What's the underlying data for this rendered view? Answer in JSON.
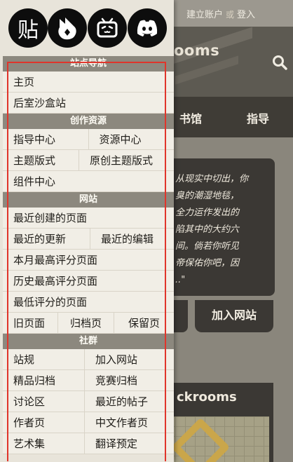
{
  "background": {
    "create_account": "建立账户",
    "or": "或",
    "login": "登入",
    "site_name_partial": "ooms",
    "nav_library": "书馆",
    "nav_guide": "指导",
    "quote_lines": [
      "从现实中切出，你",
      "臭的潮湿地毯，",
      "全力运作发出的",
      "陷其中的大约六",
      "间。倘若你听见",
      "帝保佑你吧，因",
      "..\""
    ],
    "join_button": "加入网站",
    "card_title": "ckrooms"
  },
  "social": {
    "tieba_glyph": "贴",
    "icons": [
      "tieba-icon",
      "fandom-icon",
      "bilibili-icon",
      "discord-icon"
    ]
  },
  "menu": {
    "sections": [
      {
        "title": "站点导航",
        "rows": [
          [
            "主页"
          ],
          [
            "后室沙盒站"
          ]
        ]
      },
      {
        "title": "创作资源",
        "rows": [
          [
            "指导中心",
            "资源中心"
          ],
          [
            "主题版式",
            "原创主题版式"
          ],
          [
            "组件中心"
          ]
        ]
      },
      {
        "title": "网站",
        "rows": [
          [
            "最近创建的页面"
          ],
          [
            "最近的更新",
            "最近的编辑"
          ],
          [
            "本月最高评分页面"
          ],
          [
            "历史最高评分页面"
          ],
          [
            "最低评分的页面"
          ],
          [
            "旧页面",
            "归档页",
            "保留页"
          ]
        ]
      },
      {
        "title": "社群",
        "rows": [
          [
            "站规",
            "加入网站"
          ],
          [
            "精品归档",
            "竞赛归档"
          ],
          [
            "讨论区",
            "最近的帖子"
          ],
          [
            "作者页",
            "中文作者页"
          ],
          [
            "艺术集",
            "翻译预定"
          ]
        ]
      }
    ]
  },
  "colors": {
    "highlight": "#e0352b",
    "section_header": "#8c887e",
    "menu_bg": "#f1eee6"
  }
}
